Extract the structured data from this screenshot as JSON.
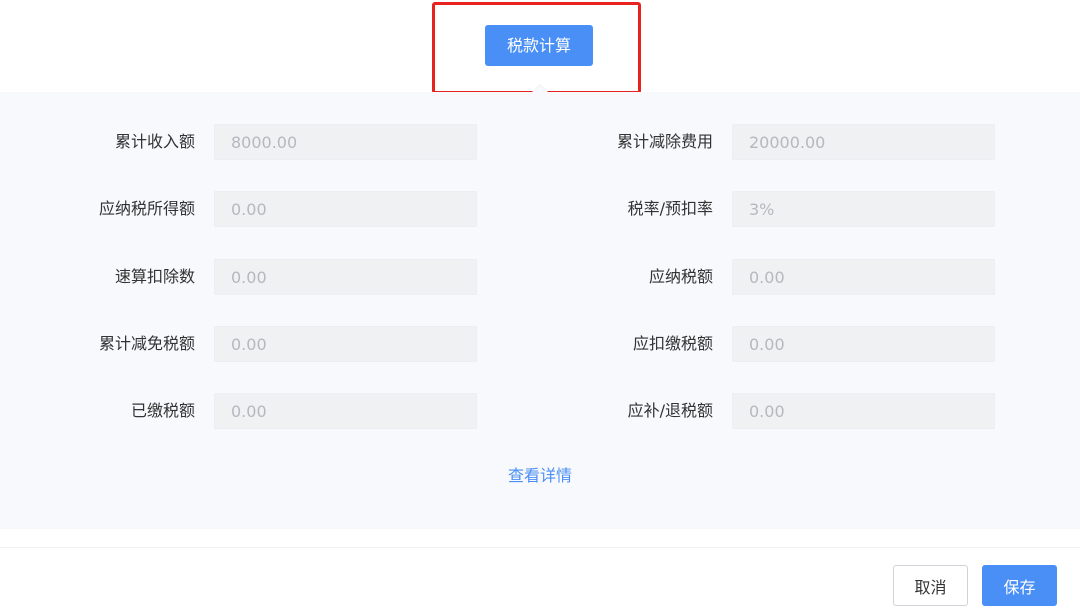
{
  "calc_button": {
    "label": "税款计算"
  },
  "fields": {
    "left": [
      {
        "label": "累计收入额",
        "value": "8000.00"
      },
      {
        "label": "应纳税所得额",
        "value": "0.00"
      },
      {
        "label": "速算扣除数",
        "value": "0.00"
      },
      {
        "label": "累计减免税额",
        "value": "0.00"
      },
      {
        "label": "已缴税额",
        "value": "0.00"
      }
    ],
    "right": [
      {
        "label": "累计减除费用",
        "value": "20000.00"
      },
      {
        "label": "税率/预扣率",
        "value": "3%"
      },
      {
        "label": "应纳税额",
        "value": "0.00"
      },
      {
        "label": "应扣缴税额",
        "value": "0.00"
      },
      {
        "label": "应补/退税额",
        "value": "0.00"
      }
    ]
  },
  "detail_link": "查看详情",
  "footer": {
    "cancel_label": "取消",
    "save_label": "保存"
  },
  "colors": {
    "accent": "#4a8ff5",
    "highlight_border": "#e8231f"
  }
}
